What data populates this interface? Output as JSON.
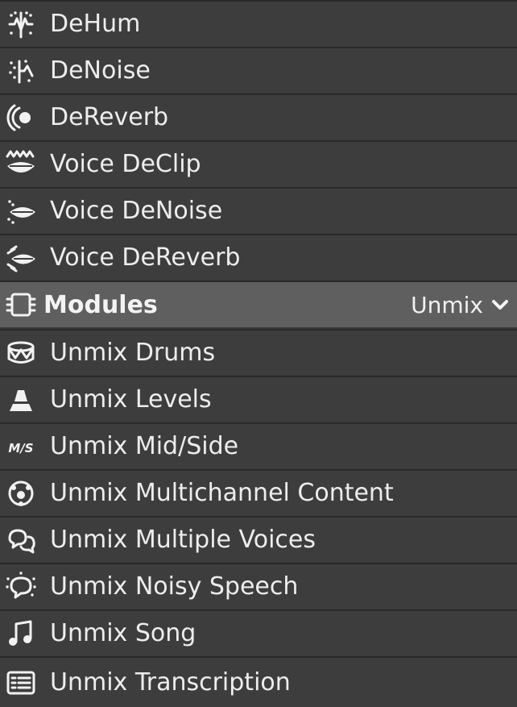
{
  "items_top": [
    {
      "label": "DeHum",
      "icon": "dehum-icon"
    },
    {
      "label": "DeNoise",
      "icon": "denoise-icon"
    },
    {
      "label": "DeReverb",
      "icon": "dereverb-icon"
    },
    {
      "label": "Voice DeClip",
      "icon": "voice-declip-icon"
    },
    {
      "label": "Voice DeNoise",
      "icon": "voice-denoise-icon"
    },
    {
      "label": "Voice DeReverb",
      "icon": "voice-dereverb-icon"
    }
  ],
  "modules_header": {
    "label": "Modules",
    "icon": "modules-icon",
    "filter_value": "Unmix",
    "filter_icon": "chevron-down-icon"
  },
  "items_bottom": [
    {
      "label": "Unmix Drums",
      "icon": "drum-icon"
    },
    {
      "label": "Unmix Levels",
      "icon": "levels-icon"
    },
    {
      "label": "Unmix Mid/Side",
      "icon": "mid-side-icon",
      "icon_text": "M/S"
    },
    {
      "label": "Unmix Multichannel Content",
      "icon": "multichannel-icon"
    },
    {
      "label": "Unmix Multiple Voices",
      "icon": "multiple-voices-icon"
    },
    {
      "label": "Unmix Noisy Speech",
      "icon": "noisy-speech-icon"
    },
    {
      "label": "Unmix Song",
      "icon": "music-note-icon"
    },
    {
      "label": "Unmix Transcription",
      "icon": "transcription-icon"
    }
  ],
  "colors": {
    "row_bg": "#3d3d3d",
    "header_bg": "#5f5f5f",
    "divider": "#2a2a2a",
    "text": "#ededed"
  }
}
